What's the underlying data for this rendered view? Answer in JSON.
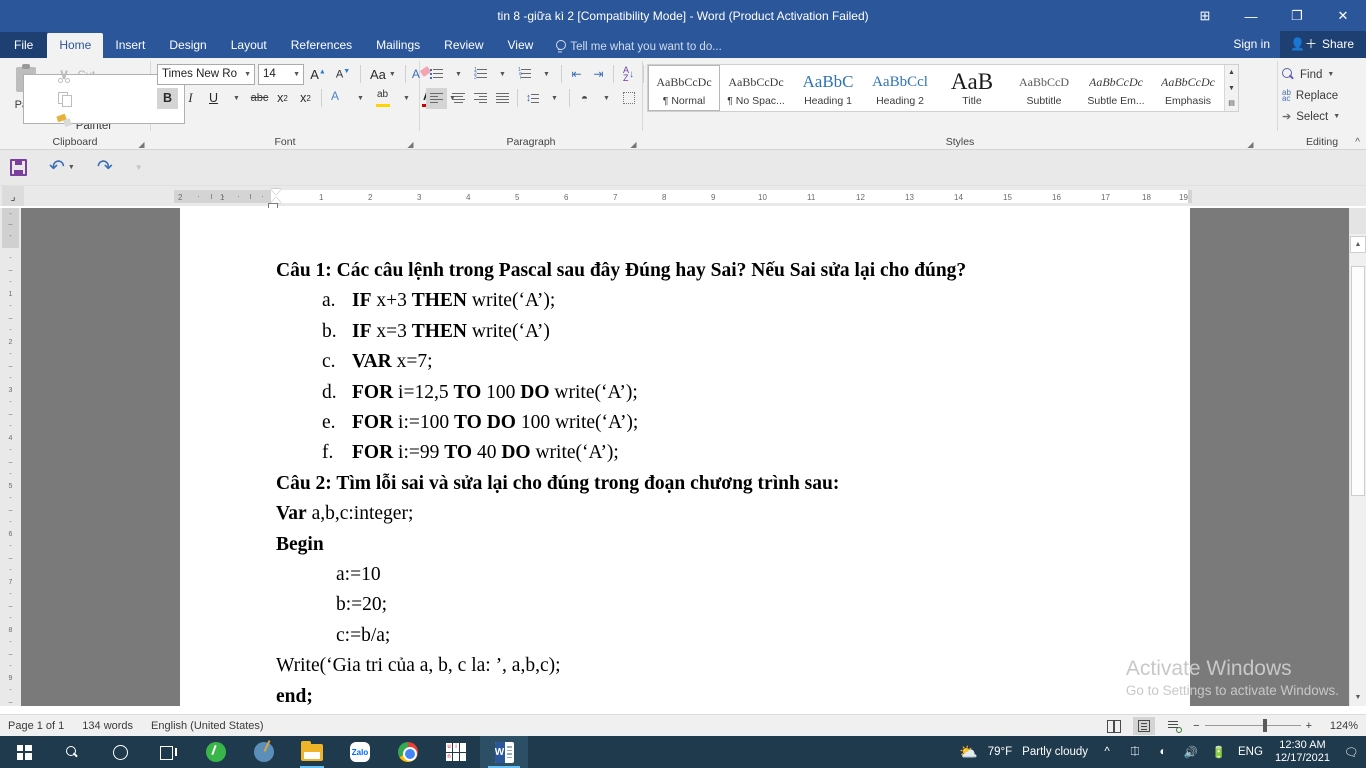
{
  "window": {
    "title": "tin 8 -giữa kì 2 [Compatibility Mode] - Word (Product Activation Failed)",
    "ribbon_display_label": "⊞",
    "minimize_label": "—",
    "restore_label": "❐",
    "close_label": "✕"
  },
  "account": {
    "sign_in": "Sign in",
    "share": "Share"
  },
  "tabs": [
    {
      "label": "File"
    },
    {
      "label": "Home"
    },
    {
      "label": "Insert"
    },
    {
      "label": "Design"
    },
    {
      "label": "Layout"
    },
    {
      "label": "References"
    },
    {
      "label": "Mailings"
    },
    {
      "label": "Review"
    },
    {
      "label": "View"
    }
  ],
  "tellme": {
    "placeholder": "Tell me what you want to do..."
  },
  "quick_access": {
    "save": "Save",
    "undo": "Undo",
    "redo": "Repeat",
    "customize": "Customize Quick Access Toolbar"
  },
  "ribbon": {
    "clipboard": {
      "group_name": "Clipboard",
      "paste": "Paste",
      "cut": "Cut",
      "copy": "Copy",
      "format_painter": "Format Painter"
    },
    "font": {
      "group_name": "Font",
      "font_name": "Times New Ro",
      "font_size": "14",
      "grow_font": "A",
      "shrink_font": "A",
      "change_case": "Aa",
      "clear_formatting": "A",
      "bold": "B",
      "italic": "I",
      "underline": "U",
      "strikethrough": "abc",
      "subscript": "x",
      "superscript": "x",
      "text_effects": "A",
      "highlight": "ab",
      "font_color": "A"
    },
    "paragraph": {
      "group_name": "Paragraph",
      "bullets": "Bullets",
      "numbering": "Numbering",
      "multilevel": "Multilevel List",
      "decrease_indent": "Decrease Indent",
      "increase_indent": "Increase Indent",
      "sort": "Sort",
      "show_marks": "¶",
      "align_left": "Align Left",
      "center": "Center",
      "align_right": "Align Right",
      "justify": "Justify",
      "line_spacing": "Line and Paragraph Spacing",
      "shading": "Shading",
      "borders": "Borders"
    },
    "styles": {
      "group_name": "Styles",
      "items": [
        {
          "preview": "AaBbCcDc",
          "name": "¶ Normal",
          "selected": true
        },
        {
          "preview": "AaBbCcDc",
          "name": "¶ No Spac...",
          "selected": false
        },
        {
          "preview": "AaBbC",
          "name": "Heading 1",
          "selected": false
        },
        {
          "preview": "AaBbCcl",
          "name": "Heading 2",
          "selected": false
        },
        {
          "preview": "AaB",
          "name": "Title",
          "selected": false
        },
        {
          "preview": "AaBbCcD",
          "name": "Subtitle",
          "selected": false
        },
        {
          "preview": "AaBbCcDc",
          "name": "Subtle Em...",
          "selected": false
        },
        {
          "preview": "AaBbCcDc",
          "name": "Emphasis",
          "selected": false
        }
      ]
    },
    "editing": {
      "group_name": "Editing",
      "find": "Find",
      "replace": "Replace",
      "select": "Select"
    }
  },
  "ruler": {
    "left_ticks": [
      "2",
      "1"
    ],
    "ticks": [
      "1",
      "2",
      "3",
      "4",
      "5",
      "6",
      "7",
      "8",
      "9",
      "10",
      "11",
      "12",
      "13",
      "14",
      "15",
      "16",
      "17",
      "18",
      "19"
    ],
    "vertical_ticks": [
      "1",
      "2",
      "3",
      "4",
      "5",
      "6",
      "7",
      "8",
      "9"
    ]
  },
  "document": {
    "question1": "Câu 1: Các câu lệnh trong Pascal sau đây Đúng hay Sai? Nếu Sai sửa lại cho đúng?",
    "items": [
      {
        "marker": "a.",
        "kw1": "IF",
        "mid1": " x+3 ",
        "kw2": "THEN",
        "rest": "  write(‘A’);"
      },
      {
        "marker": "b.",
        "kw1": "IF",
        "mid1": " x=3 ",
        "kw2": "THEN",
        "rest": "  write(‘A’)"
      },
      {
        "marker": "c.",
        "kw1": "VAR",
        "mid1": "  x=7;",
        "kw2": "",
        "rest": ""
      },
      {
        "marker": "d.",
        "kw1": "FOR",
        "mid1": "   i=12,5  ",
        "kw2": "TO",
        "rest": "  100  ",
        "kw3": "DO",
        "rest2": " write(‘A’);"
      },
      {
        "marker": "e.",
        "kw1": "FOR",
        "mid1": "  i:=100  ",
        "kw2": "TO",
        "rest": "    ",
        "kw3": "DO",
        "rest2": "  100   write(‘A’);"
      },
      {
        "marker": "f.",
        "kw1": "FOR",
        "mid1": "  i:=99  ",
        "kw2": "TO",
        "rest": " 40  ",
        "kw3": "DO",
        "rest2": " write(‘A’);"
      }
    ],
    "question2": "Câu 2: Tìm lỗi sai và sửa lại cho đúng trong đoạn chương trình sau:",
    "code": [
      {
        "bold": "Var",
        "rest": "   a,b,c:integer;",
        "indent": false
      },
      {
        "bold": "Begin",
        "rest": "",
        "indent": false
      },
      {
        "bold": "",
        "rest": "a:=10",
        "indent": true
      },
      {
        "bold": "",
        "rest": "b:=20;",
        "indent": true
      },
      {
        "bold": "",
        "rest": "c:=b/a;",
        "indent": true
      },
      {
        "bold": "",
        "rest": "Write(‘Gia tri của a, b, c la: ’, a,b,c);",
        "indent": false
      },
      {
        "bold": "end;",
        "rest": "",
        "indent": false
      }
    ]
  },
  "watermark": {
    "line1": "Activate Windows",
    "line2": "Go to Settings to activate Windows."
  },
  "status": {
    "page": "Page 1 of 1",
    "words": "134 words",
    "language": "English (United States)",
    "read_mode": "Read Mode",
    "print_layout": "Print Layout",
    "web_layout": "Web Layout",
    "zoom_out": "−",
    "zoom_in": "+",
    "zoom": "124%"
  },
  "taskbar": {
    "start": "start-button",
    "search": "search",
    "cortana": "cortana",
    "task_view": "task-view",
    "apps": [
      {
        "name": "green-app"
      },
      {
        "name": "paint"
      },
      {
        "name": "file-explorer"
      },
      {
        "name": "zalo",
        "label": "Zalo"
      },
      {
        "name": "chrome"
      },
      {
        "name": "unikey",
        "keys": [
          "u",
          "i",
          "n"
        ]
      },
      {
        "name": "word",
        "label": "W"
      }
    ],
    "weather": {
      "temp": "79°F",
      "condition": "Partly cloudy"
    },
    "language": "ENG",
    "time": "12:30 AM",
    "date": "12/17/2021"
  },
  "colors": {
    "word_blue": "#2b579a",
    "ribbon_bg": "#f2f2f2",
    "taskbar": "#1f3a4d",
    "accent": "#67c1f5"
  }
}
